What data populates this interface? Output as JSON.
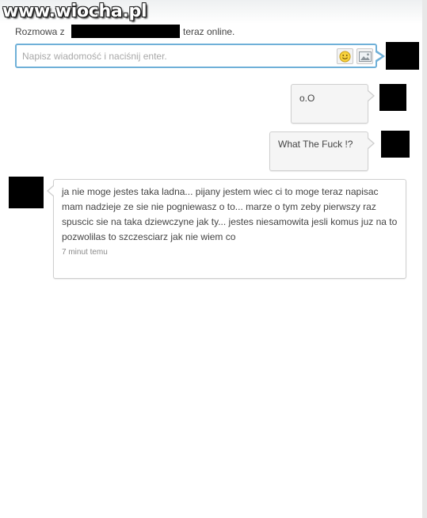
{
  "watermark": {
    "text": "www.wiocha.pl"
  },
  "conversation": {
    "header_prefix": "Rozmowa z",
    "header_suffix": "teraz online."
  },
  "compose": {
    "placeholder": "Napisz wiadomość i naciśnij enter.",
    "emoji_icon": "smiley-icon",
    "image_icon": "image-icon"
  },
  "messages": [
    {
      "direction": "outgoing",
      "text": "o.O"
    },
    {
      "direction": "outgoing",
      "text": "What The Fuck !?"
    },
    {
      "direction": "incoming",
      "text": "ja nie moge jestes taka ladna... pijany jestem wiec ci to moge teraz napisac mam nadzieje ze sie nie pogniewasz o to... marze o tym zeby pierwszy raz spuscic sie na taka dziewczyne jak ty... jestes niesamowita jesli komus juz na to pozwolilas to szczesciarz jak nie wiem co",
      "time": "7 minut temu"
    }
  ],
  "colors": {
    "accent": "#6fb0d8",
    "bubble_bg": "#f5f5f5",
    "bubble_border": "#cfcfcf",
    "redaction": "#000000"
  }
}
